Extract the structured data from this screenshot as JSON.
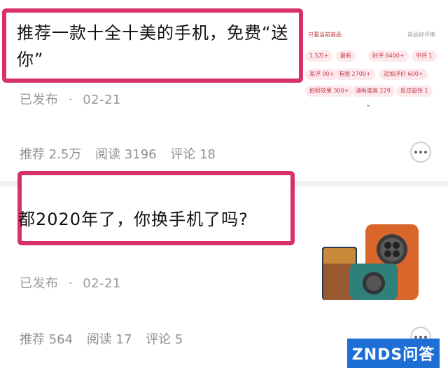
{
  "posts": [
    {
      "title": "推荐一款十全十美的手机，免费“送你”",
      "status": "已发布",
      "dot": "·",
      "date": "02-21",
      "stats": {
        "recommend": "推荐 2.5万",
        "read": "阅读 3196",
        "comment": "评论 18"
      },
      "thumb": {
        "header_left": "只看当前商品",
        "header_right": "商品好评率",
        "tags": [
          "1.5万+",
          "最新",
          "好评 6400+",
          "中评 1",
          "差评 90+",
          "有图 2700+",
          "追加评价 600+",
          "拍照效果 300+",
          "清晰度高 229",
          "反应超快 1"
        ]
      }
    },
    {
      "title": "都2020年了，你换手机了吗?",
      "status": "已发布",
      "dot": "·",
      "date": "02-21",
      "stats": {
        "recommend": "推荐 564",
        "read": "阅读 17",
        "comment": "评论 5"
      }
    }
  ],
  "watermark": "ZNDS问答",
  "colors": {
    "highlight": "#d8306a",
    "watermark_bg": "#1d6fd6",
    "tag_bg": "#fde9ec",
    "tag_text": "#c23a4c"
  }
}
